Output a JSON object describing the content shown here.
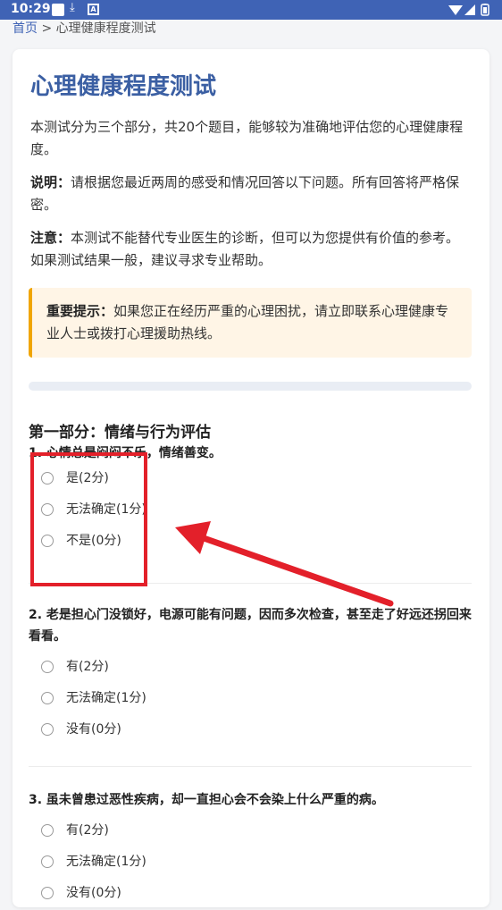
{
  "status_bar": {
    "time": "10:29"
  },
  "breadcrumb": {
    "home": "首页",
    "separator": " > ",
    "current": "心理健康程度测试"
  },
  "page": {
    "title": "心理健康程度测试",
    "intro": "本测试分为三个部分，共20个题目，能够较为准确地评估您的心理健康程度。",
    "instruction_label": "说明：",
    "instruction_text": "请根据您最近两周的感受和情况回答以下问题。所有回答将严格保密。",
    "note_label": "注意：",
    "note_text": "本测试不能替代专业医生的诊断，但可以为您提供有价值的参考。如果测试结果一般，建议寻求专业帮助。",
    "important_label": "重要提示：",
    "important_text": "如果您正在经历严重的心理困扰，请立即联系心理健康专业人士或拨打心理援助热线。",
    "progress": 0,
    "section_title": "第一部分：情绪与行为评估"
  },
  "questions": [
    {
      "text": "1. 心情总是闷闷不乐，情绪善变。",
      "options": [
        "是(2分)",
        "无法确定(1分)",
        "不是(0分)"
      ]
    },
    {
      "text": "2. 老是担心门没锁好，电源可能有问题，因而多次检查，甚至走了好远还拐回来看看。",
      "options": [
        "有(2分)",
        "无法确定(1分)",
        "没有(0分)"
      ]
    },
    {
      "text": "3. 虽未曾患过恶性疾病，却一直担心会不会染上什么严重的病。",
      "options": [
        "有(2分)",
        "无法确定(1分)",
        "没有(0分)"
      ]
    }
  ],
  "colors": {
    "status_bar": "#3f63b5",
    "title": "#3b5fa3",
    "notice_border": "#f0a500",
    "annotation": "#e3202a"
  }
}
